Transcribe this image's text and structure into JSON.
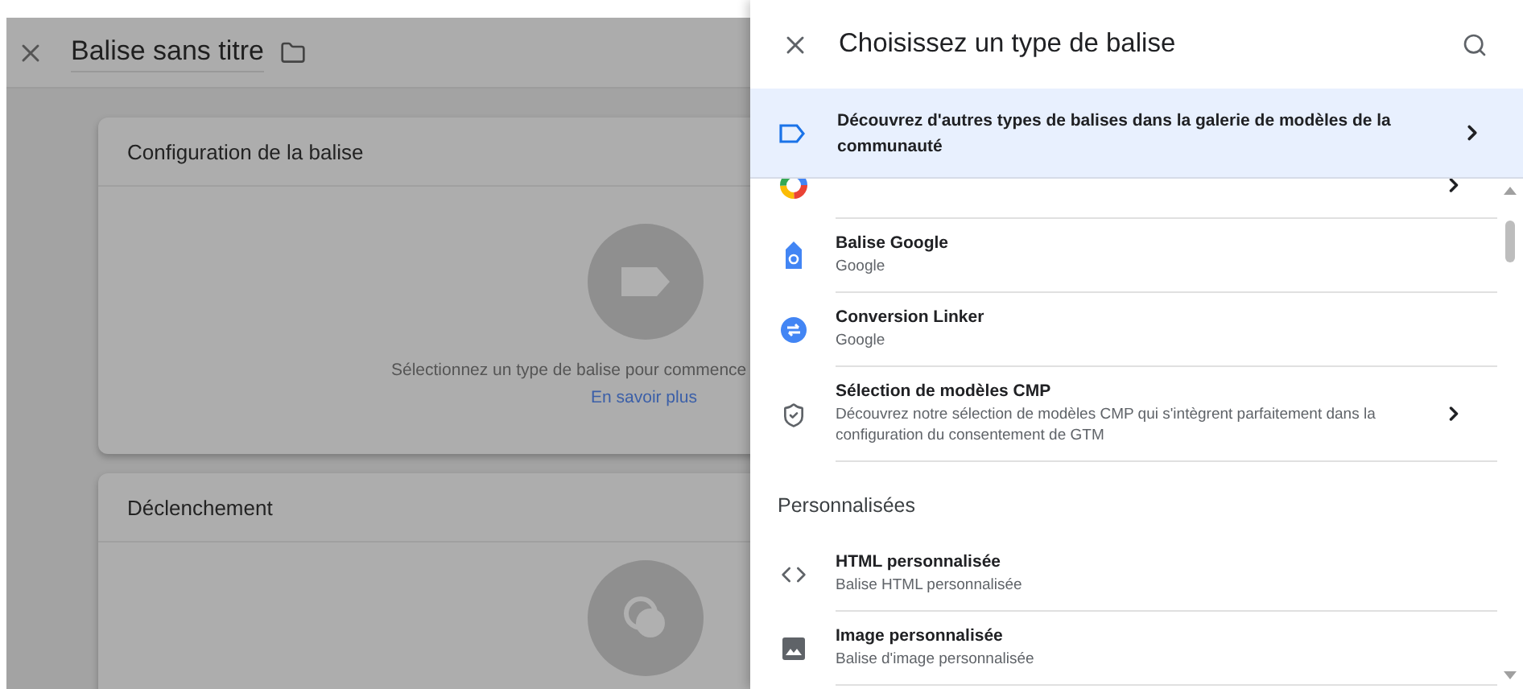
{
  "editor": {
    "title": "Balise sans titre",
    "cards": [
      {
        "title": "Configuration de la balise",
        "kind": "tag",
        "prompt": "Sélectionnez un type de balise pour commence",
        "link": "En savoir plus"
      },
      {
        "title": "Déclenchement",
        "kind": "trigger"
      }
    ]
  },
  "panel": {
    "title": "Choisissez un type de balise",
    "banner": {
      "text": "Découvrez d'autres types de balises dans la galerie de modèles de la communauté"
    },
    "sections": [
      {
        "items": [
          {
            "kind": "floodlight",
            "chevron": true
          },
          {
            "title": "Balise Google",
            "subtitle": "Google",
            "kind": "google-tag",
            "chevron": false
          },
          {
            "title": "Conversion Linker",
            "subtitle": "Google",
            "kind": "linker",
            "chevron": false
          },
          {
            "title": "Sélection de modèles CMP",
            "subtitle": "Découvrez notre sélection de modèles CMP qui s'intègrent parfaitement dans la configuration du consentement de GTM",
            "kind": "shield",
            "chevron": true
          }
        ]
      },
      {
        "heading": "Personnalisées",
        "items": [
          {
            "title": "HTML personnalisée",
            "subtitle": "Balise HTML personnalisée",
            "kind": "code",
            "chevron": false
          },
          {
            "title": "Image personnalisée",
            "subtitle": "Balise d'image personnalisée",
            "kind": "image",
            "chevron": false
          }
        ]
      }
    ]
  }
}
